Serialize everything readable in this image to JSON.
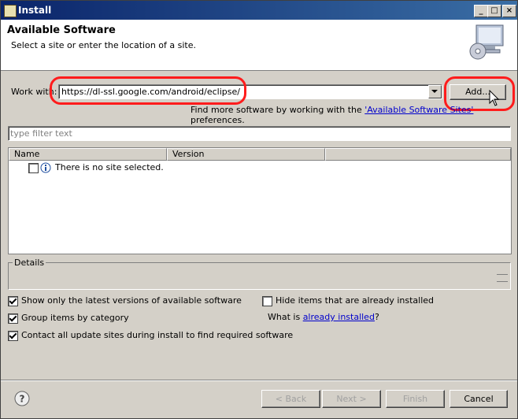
{
  "window": {
    "title": "Install"
  },
  "header": {
    "title": "Available Software",
    "subtitle": "Select a site or enter the location of a site."
  },
  "work_with": {
    "label": "Work with:",
    "value": "https://dl-ssl.google.com/android/eclipse/",
    "add_button": "Add...",
    "more_prefix": "Find more software by working with the ",
    "more_link": "'Available Software Sites'",
    "more_suffix": " preferences."
  },
  "filter": {
    "placeholder": "type filter text"
  },
  "table": {
    "columns": [
      "Name",
      "Version"
    ],
    "rows": [
      {
        "name": "There is no site selected.",
        "checked": false
      }
    ]
  },
  "details": {
    "label": "Details"
  },
  "options": {
    "show_latest": {
      "label": "Show only the latest versions of available software",
      "checked": true
    },
    "group_items": {
      "label": "Group items by category",
      "checked": true
    },
    "contact_sites": {
      "label": "Contact all update sites during install to find required software",
      "checked": true
    },
    "hide_installed": {
      "label": "Hide items that are already installed",
      "checked": false
    },
    "what_is_prefix": "What is ",
    "what_is_link": "already installed",
    "what_is_suffix": "?"
  },
  "footer": {
    "back": "< Back",
    "next": "Next >",
    "finish": "Finish",
    "cancel": "Cancel"
  }
}
